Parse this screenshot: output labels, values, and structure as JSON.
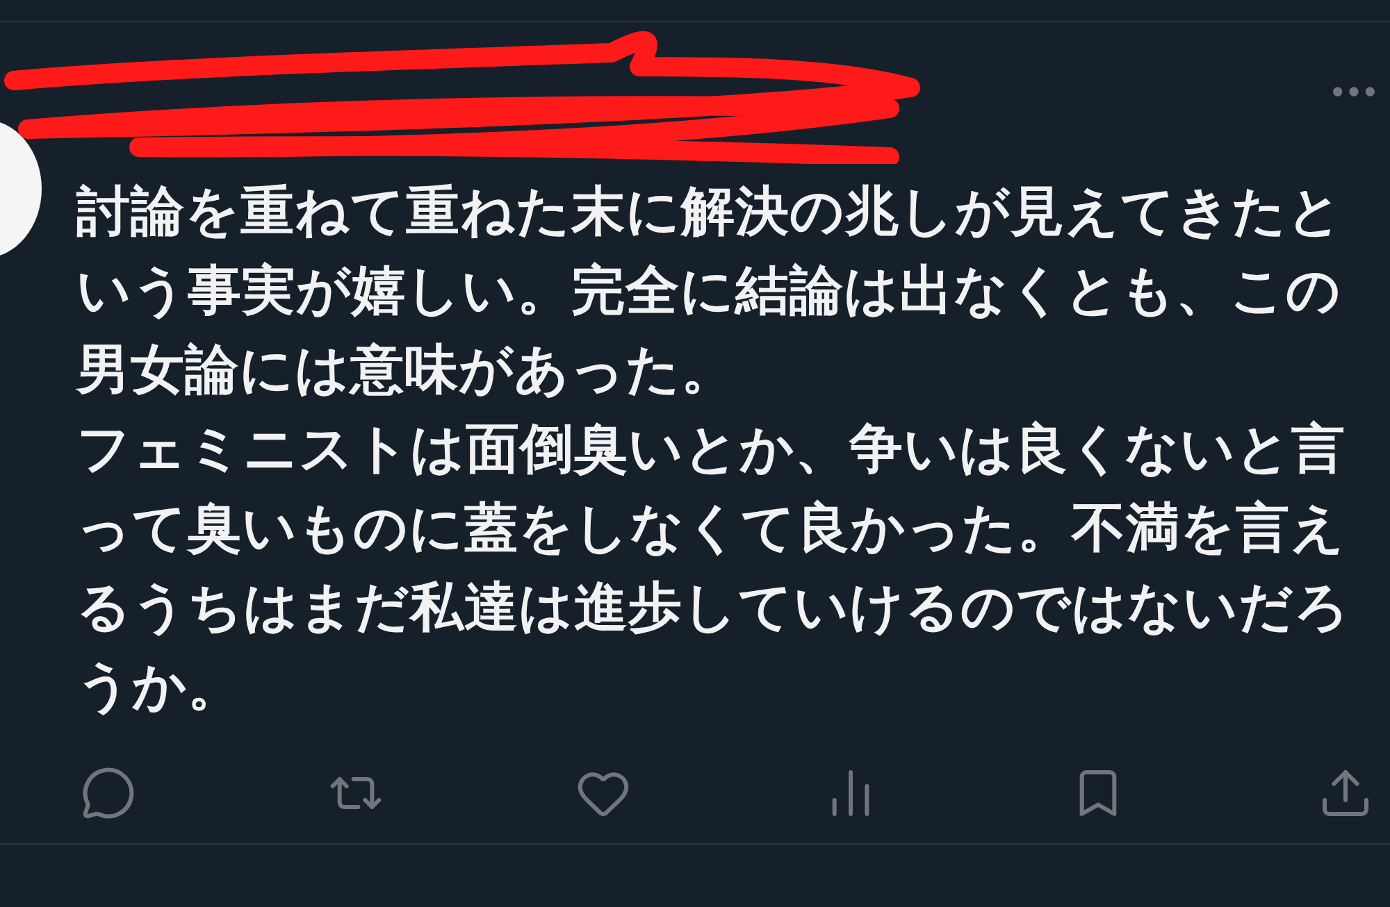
{
  "tweet": {
    "paragraphs": [
      "討論を重ねて重ねた末に解決の兆しが見えてきたという事実が嬉しい。完全に結論は出なくとも、この男女論には意味があった。",
      "フェミニストは面倒臭いとか、争いは良くないと言って臭いものに蓋をしなくて良かった。不満を言えるうちはまだ私達は進歩していけるのではないだろうか。"
    ]
  }
}
